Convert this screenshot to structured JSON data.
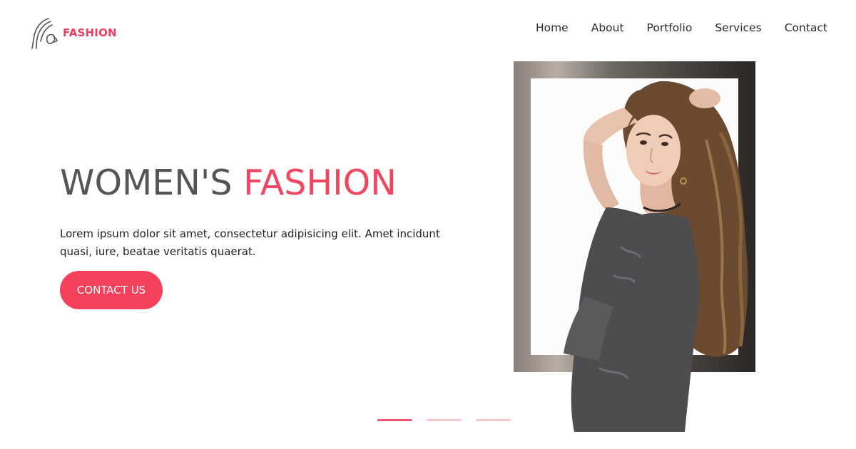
{
  "brand": {
    "name": "FASHION",
    "accent_color": "#f04661",
    "logo_icon": "woman-silhouette-icon"
  },
  "nav": {
    "items": [
      {
        "label": "Home"
      },
      {
        "label": "About"
      },
      {
        "label": "Portfolio"
      },
      {
        "label": "Services"
      },
      {
        "label": "Contact"
      }
    ]
  },
  "hero": {
    "title_part1": "WOMEN'S",
    "title_part2": "FASHION",
    "description": "Lorem ipsum dolor sit amet, consectetur adipisicing elit. Amet incidunt quasi, iure, beatae veritatis quaerat.",
    "cta_label": "CONTACT US"
  },
  "slider": {
    "count": 3,
    "active_index": 0
  },
  "colors": {
    "cta_background": "#f6415c",
    "title_dark": "#555555",
    "indicator_active": "#ee5874",
    "indicator_inactive": "#f7c6cf"
  }
}
